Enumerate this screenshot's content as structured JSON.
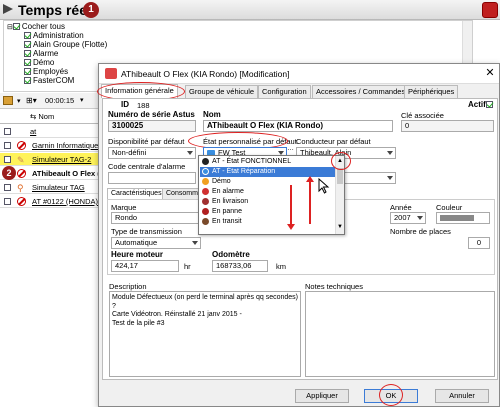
{
  "app": {
    "title": "Temps réel",
    "step1": "1",
    "step2": "2"
  },
  "tree": {
    "root": "Cocher tous",
    "items": [
      "Administration",
      "Alain Groupe (Flotte)",
      "Alarme",
      "Démo",
      "Employés",
      "FasterCOM"
    ]
  },
  "toolbar": {
    "time": "00:00:15"
  },
  "grid": {
    "col_name": "Nom",
    "col_at": "at",
    "rows": [
      {
        "name": "Garnin Informatique",
        "style": "link"
      },
      {
        "name": "Simulateur TAG-2",
        "style": "yellow"
      },
      {
        "name": "AThibeault O Flex (",
        "style": "bold"
      },
      {
        "name": "Simulateur TAG",
        "style": "link"
      },
      {
        "name": "AT #0122 (HONDA) A",
        "style": "link"
      }
    ]
  },
  "dialog": {
    "title": "AThibeault O Flex (KIA Rondo) [Modification]",
    "close": "✕",
    "tabs": [
      "Information générale",
      "Groupe de véhicule",
      "Configuration",
      "Accessoires / Commandes",
      "Périphériques"
    ],
    "id_label": "ID",
    "id_value": "188",
    "actif_label": "Actif",
    "serial_label": "Numéro de série Astus",
    "serial_value": "3100025",
    "name_label": "Nom",
    "name_value": "AThibeault O Flex (KIA Rondo)",
    "cle_label": "Clé associée",
    "cle_value": "0",
    "dispo_label": "Disponibilité par défaut",
    "dispo_value": "Non-défini",
    "etat_label": "État personnalisé par défaut",
    "etat_value": "FW Test",
    "conducteur_label": "Conducteur par défaut",
    "conducteur_value": "Thibeault, Alain",
    "code_label": "Code centrale d'alarme",
    "sub_tabs": [
      "Caractéristiques",
      "Consommatio"
    ],
    "marque_label": "Marque",
    "marque_value": "Rondo",
    "annee_label": "Année",
    "annee_value": "2007",
    "couleur_label": "Couleur",
    "transmission_label": "Type de transmission",
    "transmission_value": "Automatique",
    "places_label": "Nombre de places",
    "places_value": "0",
    "heure_label": "Heure moteur",
    "heure_value": "424,17",
    "heure_unit": "hr",
    "odometre_label": "Odomètre",
    "odometre_value": "168733,06",
    "odometre_unit": "km",
    "description_label": "Description",
    "description_lines": [
      "Module Défectueux (on perd le terminal après qq secondes) ?",
      "Carte Vidéotron. Réinstallé 21 janv 2015 -",
      "Test de la pile #3"
    ],
    "notes_label": "Notes techniques",
    "btn_apply": "Appliquer",
    "btn_ok": "OK",
    "btn_cancel": "Annuler"
  },
  "dropdown": {
    "items": [
      {
        "label": "AT - État FONCTIONNEL",
        "color": "#222222",
        "selected": false
      },
      {
        "label": "AT - État Réparation",
        "color": "#3a8fe0",
        "selected": true
      },
      {
        "label": "Démo",
        "color": "#f0a020",
        "selected": false
      },
      {
        "label": "En alarme",
        "color": "#d03030",
        "selected": false
      },
      {
        "label": "En livraison",
        "color": "#a03030",
        "selected": false
      },
      {
        "label": "En panne",
        "color": "#b02020",
        "selected": false
      },
      {
        "label": "En transit",
        "color": "#7a4a2a",
        "selected": false
      }
    ]
  },
  "colors": {
    "annotation": "#dd2222",
    "selection": "#3b7bd6",
    "highlight_row": "#fff35a"
  }
}
